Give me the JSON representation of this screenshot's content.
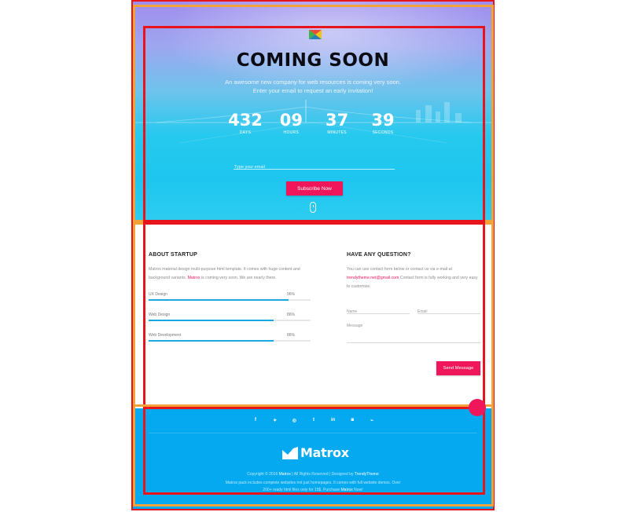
{
  "colors": {
    "accent_pink": "#f0165b",
    "skill_bar": "#1aa7e6",
    "footer_bg": "#04a9f0",
    "frame_red": "#e8141b",
    "frame_orange": "#f3a23a"
  },
  "hero": {
    "title": "COMING SOON",
    "subtitle_line1": "An awesome new company for web resources is coming very soon.",
    "subtitle_line2": "Enter your email to request an early invitation!",
    "countdown": [
      {
        "value": "432",
        "label": "DAYS"
      },
      {
        "value": "09",
        "label": "HOURS"
      },
      {
        "value": "37",
        "label": "MINUTES"
      },
      {
        "value": "39",
        "label": "SECONDS"
      }
    ],
    "email_placeholder": "Type your email",
    "subscribe_label": "Subscribe Now",
    "logo_icon": "matrox-logo-mark",
    "scroll_icon": "mouse-scroll-icon"
  },
  "about": {
    "title": "ABOUT STARTUP",
    "text_part1": "Matrox material design multi-purpose html template. It comes with huge content and background variants. ",
    "text_brand": "Matrox",
    "text_part2": " is coming very soon. We are nearly there.",
    "skills": [
      {
        "label": "UX Design",
        "percent_text": "96%",
        "value": 0.96
      },
      {
        "label": "Web Design",
        "percent_text": "86%",
        "value": 0.86
      },
      {
        "label": "Web Development",
        "percent_text": "86%",
        "value": 0.86
      }
    ]
  },
  "contact": {
    "title": "HAVE ANY QUESTION?",
    "text_part1": "You can use contact form below or contact us via e-mail at ",
    "email": "trendytheme.net@gmail.com",
    "text_part2": " Contact form is fully working and very easy to customize.",
    "name_placeholder": "Name",
    "email_placeholder": "Email",
    "message_placeholder": "Message",
    "send_label": "Send Message"
  },
  "footer": {
    "socials": [
      {
        "icon": "facebook-icon",
        "glyph": "f"
      },
      {
        "icon": "twitter-icon",
        "glyph": "✦"
      },
      {
        "icon": "dribbble-icon",
        "glyph": "◎"
      },
      {
        "icon": "tumblr-icon",
        "glyph": "t"
      },
      {
        "icon": "linkedin-icon",
        "glyph": "in"
      },
      {
        "icon": "instagram-icon",
        "glyph": "◙"
      },
      {
        "icon": "rss-icon",
        "glyph": "⌁"
      }
    ],
    "brand": "Matrox",
    "copyright_prefix": "Copyright © 2016 ",
    "copyright_brand": "Matrox",
    "copyright_mid": "  |  All Rights Reserved  |  Designed by ",
    "designer": "TrendyTheme",
    "promo_line1": "Matrox pack includes complete websites not just homepages. It comes with full website demos. Over",
    "promo_line2_prefix": "200+ ready html files only for 15$. Purchase ",
    "promo_brand": "Matrox",
    "promo_line2_suffix": " Now!"
  }
}
